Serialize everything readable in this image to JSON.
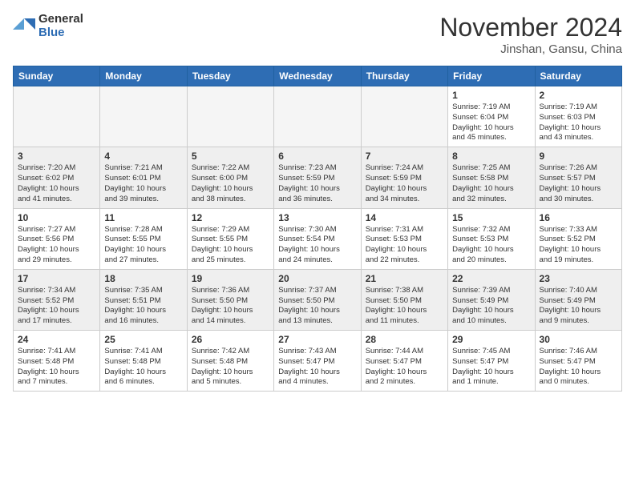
{
  "header": {
    "logo_general": "General",
    "logo_blue": "Blue",
    "title": "November 2024",
    "location": "Jinshan, Gansu, China"
  },
  "weekdays": [
    "Sunday",
    "Monday",
    "Tuesday",
    "Wednesday",
    "Thursday",
    "Friday",
    "Saturday"
  ],
  "weeks": [
    [
      {
        "day": "",
        "info": ""
      },
      {
        "day": "",
        "info": ""
      },
      {
        "day": "",
        "info": ""
      },
      {
        "day": "",
        "info": ""
      },
      {
        "day": "",
        "info": ""
      },
      {
        "day": "1",
        "info": "Sunrise: 7:19 AM\nSunset: 6:04 PM\nDaylight: 10 hours\nand 45 minutes."
      },
      {
        "day": "2",
        "info": "Sunrise: 7:19 AM\nSunset: 6:03 PM\nDaylight: 10 hours\nand 43 minutes."
      }
    ],
    [
      {
        "day": "3",
        "info": "Sunrise: 7:20 AM\nSunset: 6:02 PM\nDaylight: 10 hours\nand 41 minutes."
      },
      {
        "day": "4",
        "info": "Sunrise: 7:21 AM\nSunset: 6:01 PM\nDaylight: 10 hours\nand 39 minutes."
      },
      {
        "day": "5",
        "info": "Sunrise: 7:22 AM\nSunset: 6:00 PM\nDaylight: 10 hours\nand 38 minutes."
      },
      {
        "day": "6",
        "info": "Sunrise: 7:23 AM\nSunset: 5:59 PM\nDaylight: 10 hours\nand 36 minutes."
      },
      {
        "day": "7",
        "info": "Sunrise: 7:24 AM\nSunset: 5:59 PM\nDaylight: 10 hours\nand 34 minutes."
      },
      {
        "day": "8",
        "info": "Sunrise: 7:25 AM\nSunset: 5:58 PM\nDaylight: 10 hours\nand 32 minutes."
      },
      {
        "day": "9",
        "info": "Sunrise: 7:26 AM\nSunset: 5:57 PM\nDaylight: 10 hours\nand 30 minutes."
      }
    ],
    [
      {
        "day": "10",
        "info": "Sunrise: 7:27 AM\nSunset: 5:56 PM\nDaylight: 10 hours\nand 29 minutes."
      },
      {
        "day": "11",
        "info": "Sunrise: 7:28 AM\nSunset: 5:55 PM\nDaylight: 10 hours\nand 27 minutes."
      },
      {
        "day": "12",
        "info": "Sunrise: 7:29 AM\nSunset: 5:55 PM\nDaylight: 10 hours\nand 25 minutes."
      },
      {
        "day": "13",
        "info": "Sunrise: 7:30 AM\nSunset: 5:54 PM\nDaylight: 10 hours\nand 24 minutes."
      },
      {
        "day": "14",
        "info": "Sunrise: 7:31 AM\nSunset: 5:53 PM\nDaylight: 10 hours\nand 22 minutes."
      },
      {
        "day": "15",
        "info": "Sunrise: 7:32 AM\nSunset: 5:53 PM\nDaylight: 10 hours\nand 20 minutes."
      },
      {
        "day": "16",
        "info": "Sunrise: 7:33 AM\nSunset: 5:52 PM\nDaylight: 10 hours\nand 19 minutes."
      }
    ],
    [
      {
        "day": "17",
        "info": "Sunrise: 7:34 AM\nSunset: 5:52 PM\nDaylight: 10 hours\nand 17 minutes."
      },
      {
        "day": "18",
        "info": "Sunrise: 7:35 AM\nSunset: 5:51 PM\nDaylight: 10 hours\nand 16 minutes."
      },
      {
        "day": "19",
        "info": "Sunrise: 7:36 AM\nSunset: 5:50 PM\nDaylight: 10 hours\nand 14 minutes."
      },
      {
        "day": "20",
        "info": "Sunrise: 7:37 AM\nSunset: 5:50 PM\nDaylight: 10 hours\nand 13 minutes."
      },
      {
        "day": "21",
        "info": "Sunrise: 7:38 AM\nSunset: 5:50 PM\nDaylight: 10 hours\nand 11 minutes."
      },
      {
        "day": "22",
        "info": "Sunrise: 7:39 AM\nSunset: 5:49 PM\nDaylight: 10 hours\nand 10 minutes."
      },
      {
        "day": "23",
        "info": "Sunrise: 7:40 AM\nSunset: 5:49 PM\nDaylight: 10 hours\nand 9 minutes."
      }
    ],
    [
      {
        "day": "24",
        "info": "Sunrise: 7:41 AM\nSunset: 5:48 PM\nDaylight: 10 hours\nand 7 minutes."
      },
      {
        "day": "25",
        "info": "Sunrise: 7:41 AM\nSunset: 5:48 PM\nDaylight: 10 hours\nand 6 minutes."
      },
      {
        "day": "26",
        "info": "Sunrise: 7:42 AM\nSunset: 5:48 PM\nDaylight: 10 hours\nand 5 minutes."
      },
      {
        "day": "27",
        "info": "Sunrise: 7:43 AM\nSunset: 5:47 PM\nDaylight: 10 hours\nand 4 minutes."
      },
      {
        "day": "28",
        "info": "Sunrise: 7:44 AM\nSunset: 5:47 PM\nDaylight: 10 hours\nand 2 minutes."
      },
      {
        "day": "29",
        "info": "Sunrise: 7:45 AM\nSunset: 5:47 PM\nDaylight: 10 hours\nand 1 minute."
      },
      {
        "day": "30",
        "info": "Sunrise: 7:46 AM\nSunset: 5:47 PM\nDaylight: 10 hours\nand 0 minutes."
      }
    ]
  ]
}
